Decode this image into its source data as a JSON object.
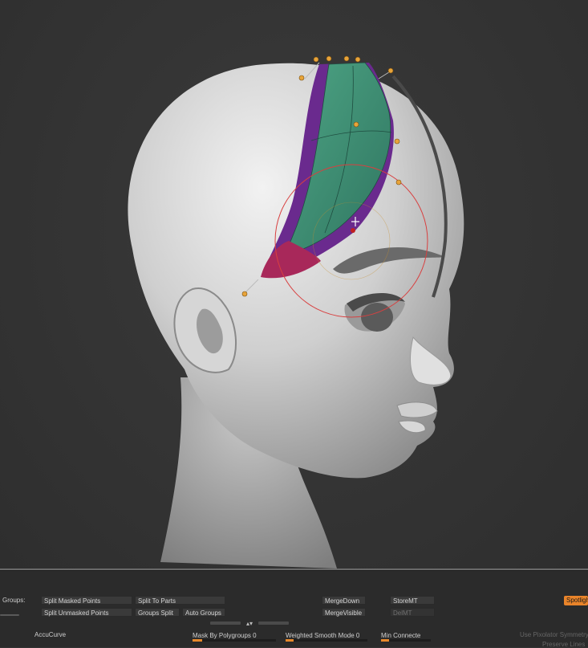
{
  "canvas": {
    "subject": "sculpted-head",
    "tool": "curve-tube",
    "colors": {
      "background": "#343434",
      "clay": "#d8d8d8",
      "stroke_green": "#3f8f72",
      "stroke_purple": "#6a2a8e",
      "stroke_red": "#a8285a",
      "control_point": "#e8a43a",
      "brush_ring": "#d84040"
    }
  },
  "panel": {
    "groups_label": "Groups:",
    "buttons": {
      "split_masked_points": "Split Masked Points",
      "split_unmasked_points": "Split Unmasked Points",
      "split_to_parts": "Split To Parts",
      "groups_split": "Groups Split",
      "auto_groups": "Auto Groups",
      "merge_down": "MergeDown",
      "merge_visible": "MergeVisible",
      "store_mt": "StoreMT",
      "del_mt": "DelMT",
      "spotlight": "Spotligh"
    },
    "accucurve_label": "AccuCurve",
    "sliders": {
      "mask_by_polygroups": {
        "label": "Mask By Polygroups",
        "value": "0",
        "level": 0.12
      },
      "weighted_smooth_mode": {
        "label": "Weighted Smooth Mode",
        "value": "0",
        "level": 0.1
      },
      "min_connected": {
        "label": "Min Connecte",
        "level": 0.15
      }
    },
    "right_faint_1": "Use Pixolator Symmetry",
    "right_faint_2": "Preserve Lines"
  }
}
